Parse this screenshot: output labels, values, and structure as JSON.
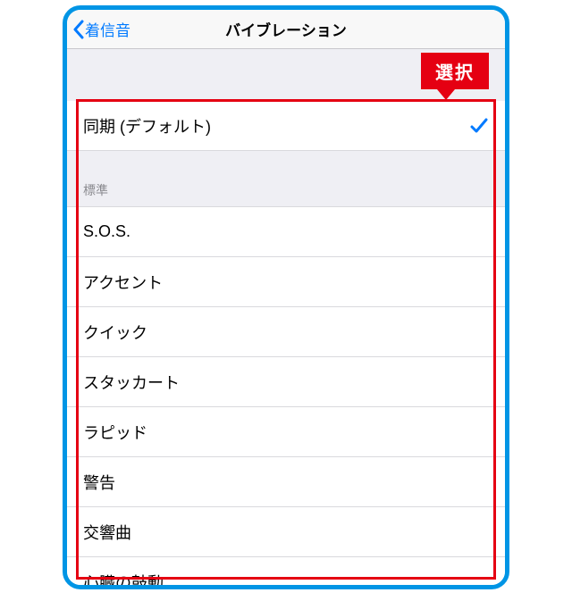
{
  "nav": {
    "back_label": "着信音",
    "title": "バイブレーション"
  },
  "callout": {
    "label": "選択"
  },
  "top_row": {
    "label": "同期 (デフォルト)",
    "selected": true
  },
  "section": {
    "header": "標準",
    "items": [
      {
        "label": "S.O.S."
      },
      {
        "label": "アクセント"
      },
      {
        "label": "クイック"
      },
      {
        "label": "スタッカート"
      },
      {
        "label": "ラピッド"
      },
      {
        "label": "警告"
      },
      {
        "label": "交響曲"
      },
      {
        "label": "心臓の鼓動"
      }
    ]
  }
}
